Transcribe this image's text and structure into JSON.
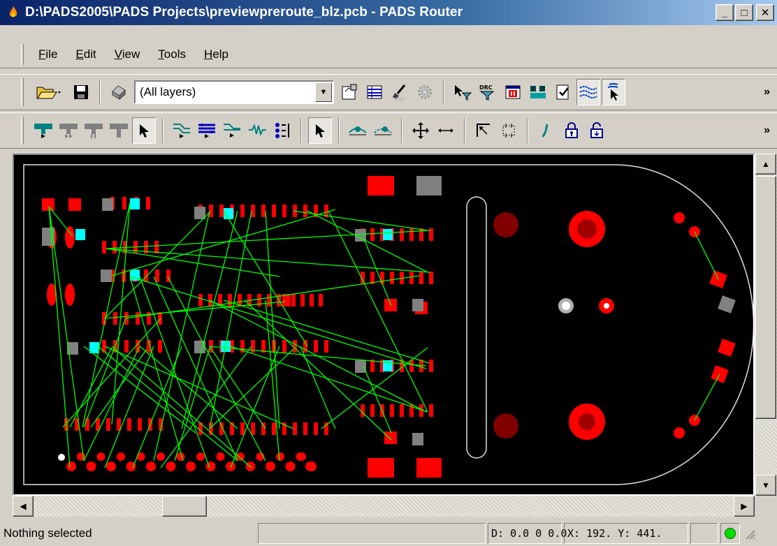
{
  "window": {
    "title": "D:\\PADS2005\\PADS Projects\\previewpreroute_blz.pcb - PADS Router",
    "minimize_glyph": "_",
    "maximize_glyph": "□",
    "close_glyph": "✕"
  },
  "menu": [
    {
      "label": "File",
      "accel": "F",
      "rest": "ile"
    },
    {
      "label": "Edit",
      "accel": "E",
      "rest": "dit"
    },
    {
      "label": "View",
      "accel": "V",
      "rest": "iew"
    },
    {
      "label": "Tools",
      "accel": "T",
      "rest": "ools"
    },
    {
      "label": "Help",
      "accel": "H",
      "rest": "elp"
    }
  ],
  "toolbar1": {
    "layer_combo_value": "(All layers)",
    "combo_arrow_glyph": "▼",
    "overflow_glyph": "»",
    "icons": [
      "open-folder-icon",
      "save-icon",
      "print-icon",
      "properties-icon",
      "spreadsheet-icon",
      "brush-icon",
      "gear-icon",
      "filter-select-icon",
      "drc-filter-icon",
      "stop-icon",
      "route-icon",
      "check-icon",
      "ratsnest-icon",
      "select-mode-icon"
    ]
  },
  "toolbar2": {
    "overflow_glyph": "»",
    "icons": [
      "route-top-icon",
      "route-mid1-icon",
      "route-mid2-icon",
      "route-bottom-icon",
      "select-arrow-icon",
      "fanout-icon",
      "bus-route-icon",
      "route-net-icon",
      "tune-icon",
      "spread-icon",
      "select-arrow2-icon",
      "add-via-icon",
      "move-via-icon",
      "move-icon",
      "stretch-icon",
      "corner-icon",
      "box-icon",
      "draw-trace-icon",
      "lock-icon",
      "unlock-icon"
    ]
  },
  "colors": {
    "canvas": "#000000",
    "pad_red": "#ff0000",
    "pad_gray": "#808080",
    "pad_cyan": "#00ffff",
    "ratsnest": "#00ff00",
    "outline": "#e0e0e0"
  },
  "scrollbars": {
    "up": "▲",
    "down": "▼",
    "left": "◀",
    "right": "▶"
  },
  "status": {
    "selection": "Nothing selected",
    "delta": "D: 0.0 0 0.0",
    "coords": "X:  192.  Y:  441."
  }
}
